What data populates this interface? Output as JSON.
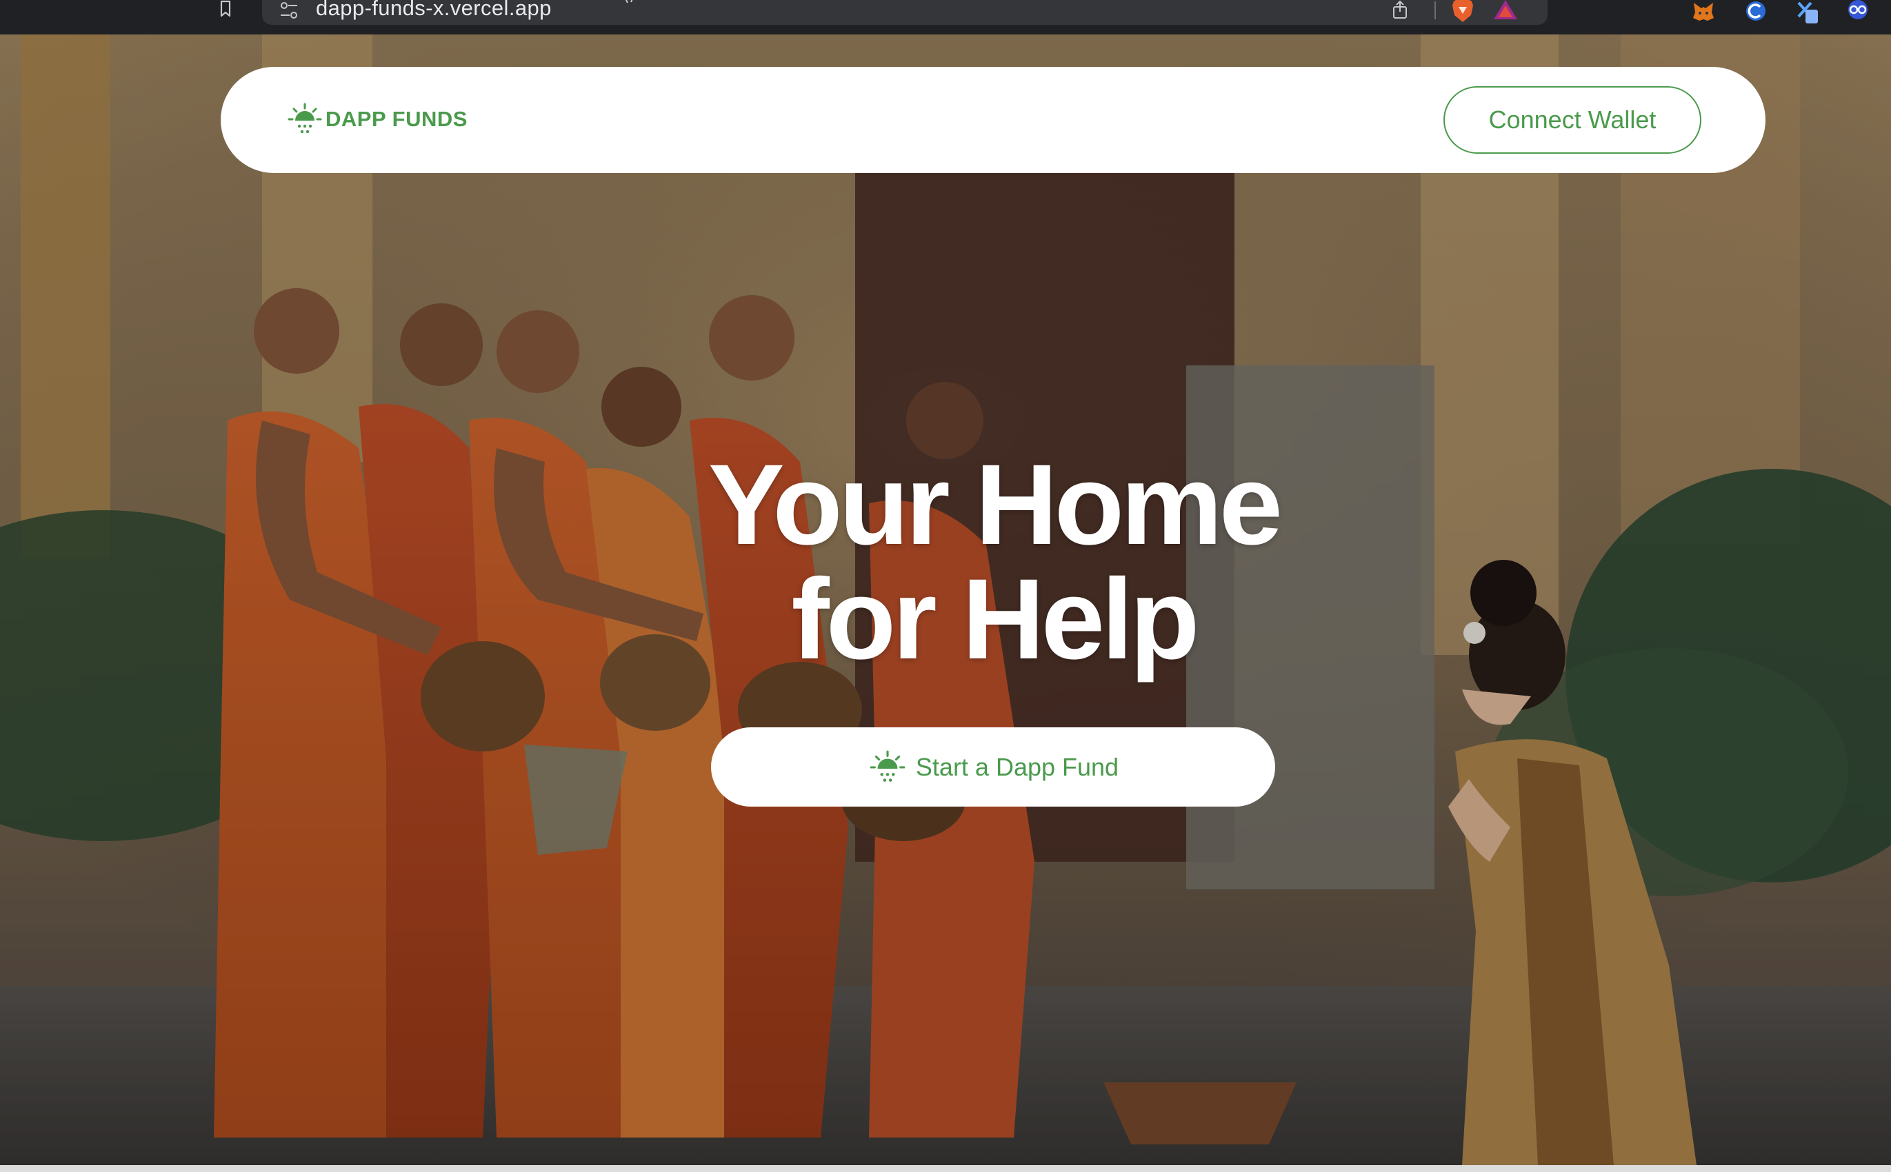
{
  "browser": {
    "url": "dapp-funds-x.vercel.app",
    "icons": [
      "bookmark-icon",
      "site-settings-icon",
      "star-icon",
      "share-icon",
      "brave-shields-icon",
      "brave-rewards-icon",
      "metamask-extension-icon",
      "extension-icon",
      "extension-icon",
      "extension-icon"
    ]
  },
  "navbar": {
    "brand": "DAPP FUNDS",
    "brand_icon": "sun-rays-icon",
    "connect_label": "Connect Wallet"
  },
  "hero": {
    "title_line1": "Your Home",
    "title_line2": "for Help",
    "cta_label": "Start a Dapp Fund",
    "cta_icon": "sun-rays-icon"
  },
  "colors": {
    "accent": "#4a9a4c",
    "navbar_bg": "#ffffff",
    "hero_text": "#ffffff",
    "browser_bar": "#202124"
  }
}
